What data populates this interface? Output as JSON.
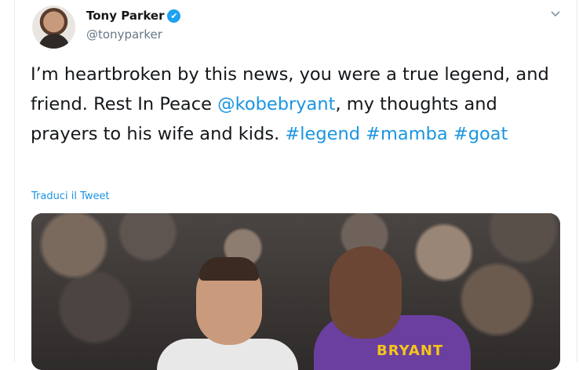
{
  "tweet": {
    "author_name": "Tony Parker",
    "author_handle": "@tonyparker",
    "text_parts": [
      "I’m heartbroken by this news, you were a true legend, and friend. Rest In Peace ",
      "@kobebryant",
      ", my thoughts and prayers to his wife and kids. ",
      "#legend",
      " ",
      "#mamba",
      " ",
      "#goat"
    ],
    "translate_label": "Traduci il Tweet",
    "verified_icon": "✔",
    "menu_icon": "chevron-down-icon"
  },
  "media": {
    "jersey_text": "BRYANT"
  },
  "colors": {
    "link": "#1b95e0",
    "verified": "#1da1f2",
    "text": "#14171a",
    "muted": "#657786"
  }
}
